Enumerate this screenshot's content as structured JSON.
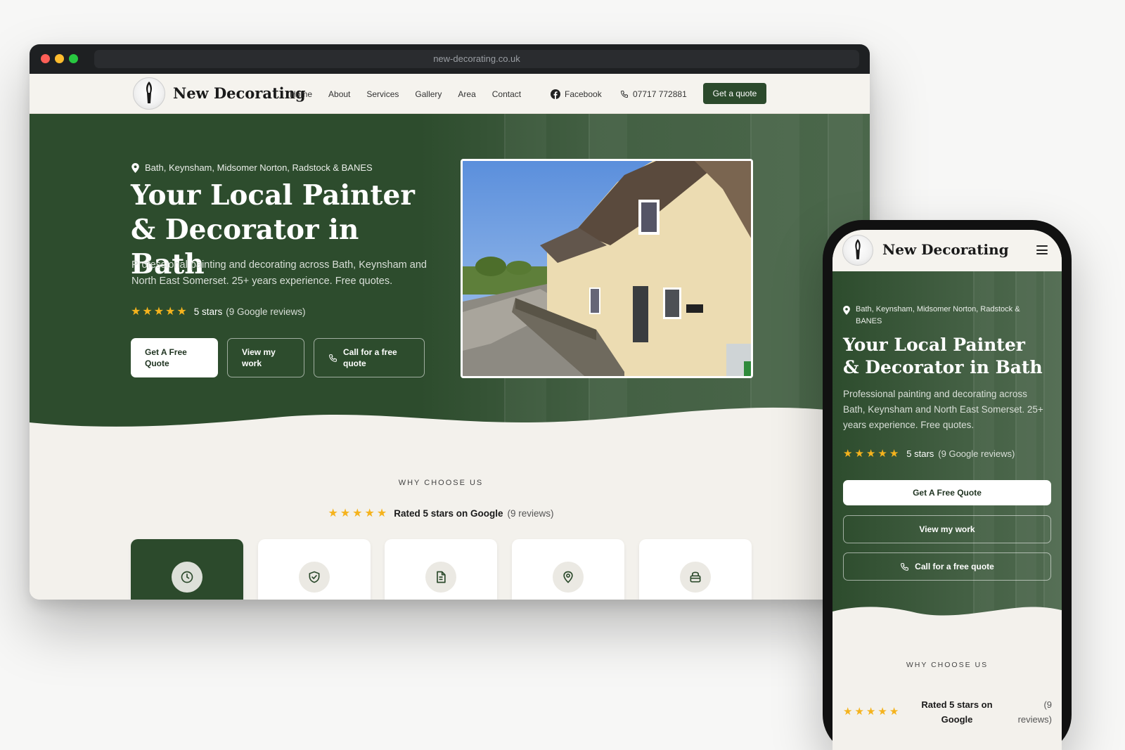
{
  "browser": {
    "url": "new-decorating.co.uk"
  },
  "brand": {
    "name": "New Decorating"
  },
  "nav": {
    "links": [
      "Home",
      "About",
      "Services",
      "Gallery",
      "Area",
      "Contact"
    ],
    "facebook": "Facebook",
    "phone": "07717 772881",
    "cta": "Get a quote"
  },
  "hero": {
    "location": "Bath, Keynsham, Midsomer Norton, Radstock & BANES",
    "title": "Your Local Painter & Decorator in Bath",
    "description": "Professional painting and decorating across Bath, Keynsham and North East Somerset. 25+ years experience. Free quotes.",
    "rating_label": "5 stars",
    "rating_count": "(9 Google reviews)",
    "rating_stars": 5,
    "btn_quote": "Get A Free Quote",
    "btn_work": "View my work",
    "btn_call": "Call for a free quote"
  },
  "why": {
    "label": "WHY CHOOSE US",
    "rated": "Rated 5 stars on Google",
    "count": "(9 reviews)",
    "cards": [
      {
        "icon": "clock-icon"
      },
      {
        "icon": "shield-check-icon"
      },
      {
        "icon": "document-icon"
      },
      {
        "icon": "map-pin-icon"
      },
      {
        "icon": "paint-bucket-icon"
      }
    ]
  },
  "colors": {
    "brand_green": "#2c4a2c",
    "star": "#f5b31d",
    "background": "#f3f1ec"
  }
}
